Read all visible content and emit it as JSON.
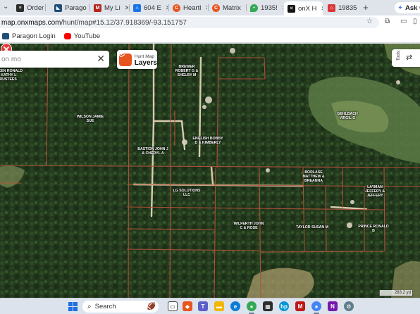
{
  "tabs": [
    {
      "label": "Order",
      "icon": "order-icon",
      "color": "#2b2b2b"
    },
    {
      "label": "Parago",
      "icon": "paragon-icon",
      "color": "#1f4e79"
    },
    {
      "label": "My Li",
      "icon": "mylistings-icon",
      "color": "#b3261e"
    },
    {
      "label": "604 E",
      "icon": "zillow-icon",
      "color": "#1a73e8"
    },
    {
      "label": "Heartl",
      "icon": "heartland-icon",
      "color": "#e8541e"
    },
    {
      "label": "Matrix",
      "icon": "matrix-icon",
      "color": "#e8541e"
    },
    {
      "label": "1935!",
      "icon": "maps-pin-icon",
      "color": "#34a853"
    },
    {
      "label": "onX H",
      "icon": "onx-icon",
      "color": "#111111",
      "active": true
    },
    {
      "label": "19835",
      "icon": "home-icon",
      "color": "#d9383a"
    }
  ],
  "toolbar": {
    "url_host": "map.onxmaps.com",
    "url_path": "/hunt/map#15.12/37.918369/-93.151757",
    "ask_gemini": "Ask Ge",
    "new_tab": "+"
  },
  "bookmarks": [
    {
      "label": "Paragon Login",
      "color": "#1f4e79"
    },
    {
      "label": "YouTube",
      "color": "#ff0000"
    }
  ],
  "map": {
    "search_text": "on mo",
    "layers_sub": "Hunt Map",
    "layers_main": "Layers",
    "tools_label": "Tools",
    "scale_text": "283.2 yd",
    "parcels": [
      "WILKEN RONALD L KATHY L TRUSTEES",
      "BREWER ROBERT G & SHELBY M",
      "WILSON JAMIE SUE",
      "GEHLBACH VIRGIL O",
      "ENGLISH BOBBY D & KIMBERLY",
      "BASTION JOHN J & CHERYL A",
      "BORLASE MATTHEW & BREANNA",
      "LAYMAN JEFFERY & JEFFERY",
      "LG SOLUTIONS LLC",
      "WILFERTH JOHN C & ROSE",
      "TAYLOR SUSAN M",
      "PRINCE RONALD B"
    ]
  },
  "taskbar": {
    "search_label": "Search",
    "apps": [
      "windows-start",
      "search",
      "widgets",
      "task-view",
      "teams",
      "file-explorer",
      "edge",
      "chrome",
      "store",
      "hp",
      "mcafee",
      "chrome-2",
      "onenote",
      "settings"
    ]
  }
}
